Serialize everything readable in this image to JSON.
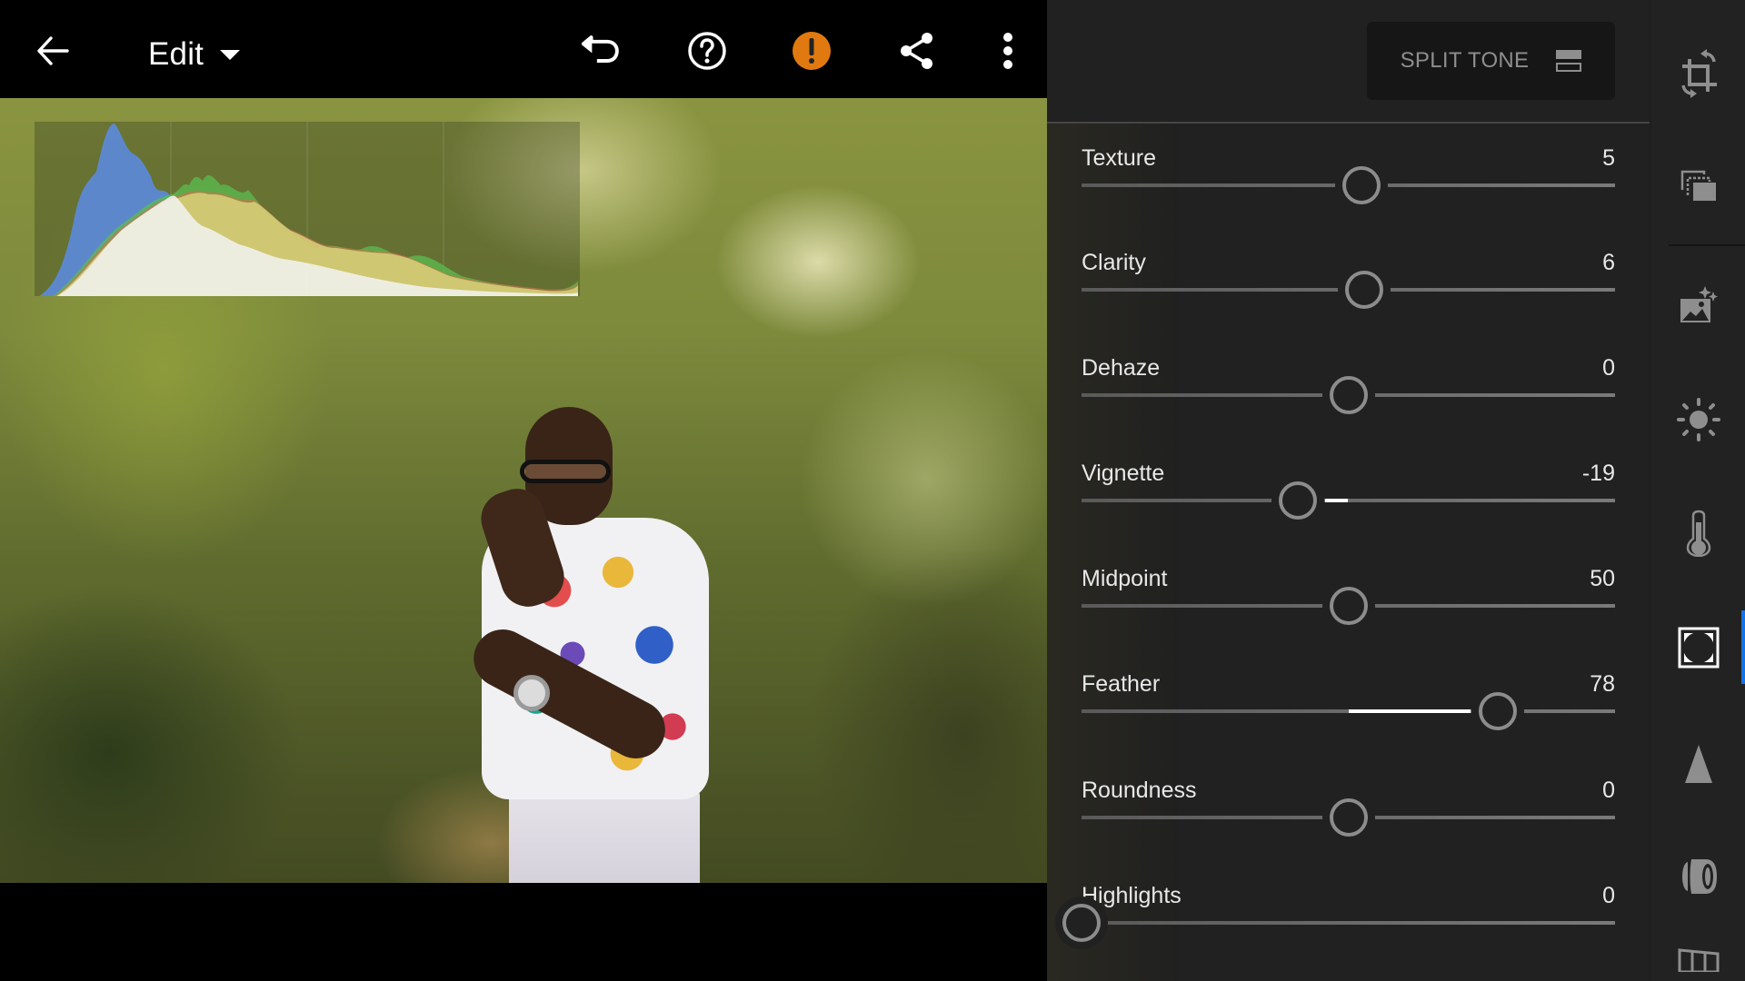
{
  "topbar": {
    "back_icon": "arrow-left-icon",
    "mode_label": "Edit",
    "mode_caret_icon": "caret-down-icon",
    "actions": [
      {
        "name": "undo",
        "icon": "undo-icon"
      },
      {
        "name": "help",
        "icon": "help-circle-icon"
      },
      {
        "name": "alert",
        "icon": "alert-circle-icon",
        "color": "#e07a10"
      },
      {
        "name": "share",
        "icon": "share-icon"
      },
      {
        "name": "more",
        "icon": "more-vertical-icon"
      }
    ]
  },
  "photo": {
    "description": "Portrait of man in floral shirt and glasses in a forest",
    "histogram_visible": true
  },
  "panel": {
    "header_button": {
      "label": "SPLIT TONE",
      "icon": "split-tone-icon"
    },
    "sliders": [
      {
        "label": "Texture",
        "value": "5",
        "numeric": 5,
        "min": -100,
        "max": 100,
        "fill": false
      },
      {
        "label": "Clarity",
        "value": "6",
        "numeric": 6,
        "min": -100,
        "max": 100,
        "fill": false
      },
      {
        "label": "Dehaze",
        "value": "0",
        "numeric": 0,
        "min": -100,
        "max": 100,
        "fill": false
      },
      {
        "label": "Vignette",
        "value": "-19",
        "numeric": -19,
        "min": -100,
        "max": 100,
        "fill": true
      },
      {
        "label": "Midpoint",
        "value": "50",
        "numeric": 50,
        "min": 0,
        "max": 100,
        "fill": false
      },
      {
        "label": "Feather",
        "value": "78",
        "numeric": 78,
        "min": 0,
        "max": 100,
        "fill": true,
        "fill_from": 50
      },
      {
        "label": "Roundness",
        "value": "0",
        "numeric": 0,
        "min": -100,
        "max": 100,
        "fill": false
      },
      {
        "label": "Highlights",
        "value": "0",
        "numeric": 0,
        "min": 0,
        "max": 100,
        "fill": false
      }
    ]
  },
  "toolstrip": {
    "items": [
      {
        "name": "crop",
        "icon": "crop-rotate-icon",
        "active": false
      },
      {
        "name": "presets",
        "icon": "presets-icon",
        "active": false
      },
      {
        "name": "auto",
        "icon": "auto-enhance-icon",
        "active": false
      },
      {
        "name": "light",
        "icon": "light-sun-icon",
        "active": false
      },
      {
        "name": "color",
        "icon": "thermometer-icon",
        "active": false
      },
      {
        "name": "effects",
        "icon": "effects-vignette-icon",
        "active": true
      },
      {
        "name": "detail",
        "icon": "detail-triangle-icon",
        "active": false
      },
      {
        "name": "optics",
        "icon": "optics-lens-icon",
        "active": false
      },
      {
        "name": "geometry",
        "icon": "geometry-icon",
        "active": false
      }
    ],
    "active_color": "#1473e6"
  }
}
